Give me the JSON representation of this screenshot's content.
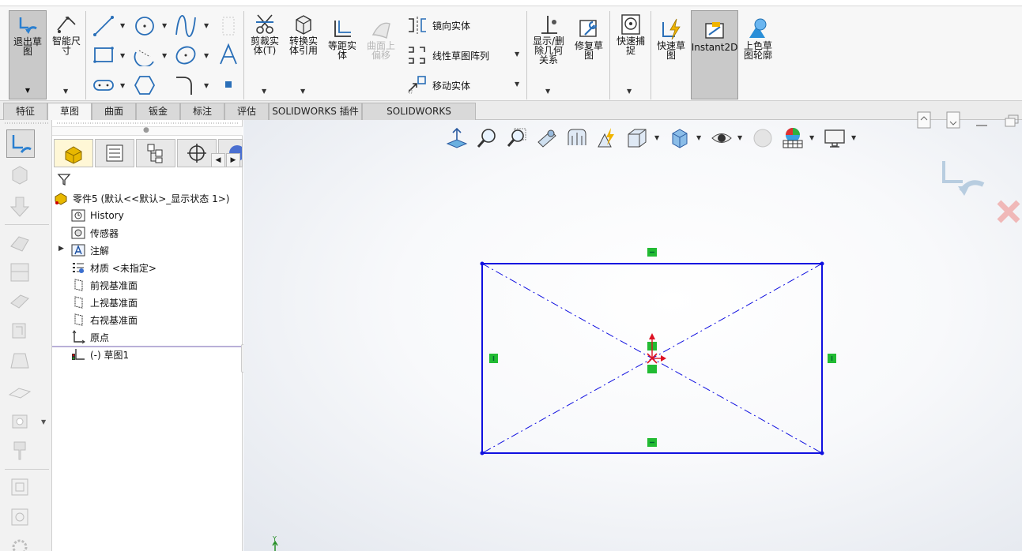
{
  "ribbon": {
    "exit_sketch": "退出草\n图",
    "smart_dim": "智能尺\n寸",
    "trim": "剪裁实\n体(T)",
    "convert": "转换实\n体引用",
    "offset": "等距实\n体",
    "surface_offset": "曲面上\n偏移",
    "mirror": "镜向实体",
    "linear_pattern": "线性草图阵列",
    "move": "移动实体",
    "show_relations": "显示/删\n除几何\n关系",
    "repair": "修复草\n图",
    "quick_snap": "快速捕\n捉",
    "rapid_sketch": "快速草\n图",
    "instant2d": "Instant2D",
    "shaded_contours": "上色草\n图轮廓"
  },
  "tabs": [
    {
      "label": "特征"
    },
    {
      "label": "草图"
    },
    {
      "label": "曲面"
    },
    {
      "label": "钣金"
    },
    {
      "label": "标注"
    },
    {
      "label": "评估"
    },
    {
      "label": "SOLIDWORKS 插件"
    },
    {
      "label": "SOLIDWORKS Inspection"
    }
  ],
  "tree": {
    "root": "零件5  (默认<<默认>_显示状态 1>)",
    "items": [
      {
        "label": "History"
      },
      {
        "label": "传感器"
      },
      {
        "label": "注解"
      },
      {
        "label": "材质 <未指定>"
      },
      {
        "label": "前视基准面"
      },
      {
        "label": "上视基准面"
      },
      {
        "label": "右视基准面"
      },
      {
        "label": "原点"
      },
      {
        "label": "(-) 草图1"
      }
    ]
  },
  "triad": {
    "y_label": "Y"
  },
  "colors": {
    "sketch_line": "#1010e0",
    "relation_marker": "#22bb33",
    "origin": "#dd1122",
    "selected_tab": "#f6f6f6"
  }
}
